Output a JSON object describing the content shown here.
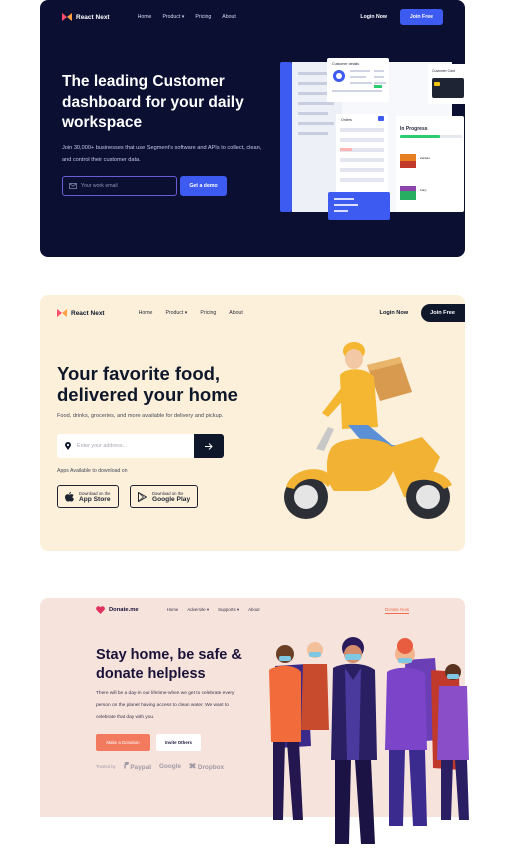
{
  "card1": {
    "brand": "React Next",
    "nav": [
      "Home",
      "Product ▾",
      "Pricing",
      "About"
    ],
    "login": "Login Now",
    "join": "Join Free",
    "title": "The leading Customer dashboard for your daily workspace",
    "subtitle": "Join 30,000+ businesses that use Segment's software and APIs to collect, clean, and control their customer data.",
    "email_placeholder": "Your work email",
    "demo_label": "Get a demo",
    "mock": {
      "customer_details": "Customer details",
      "orders": "Orders",
      "in_progress": "In Progress",
      "customer_card": "Customer Card",
      "book1": "Zeldaro — Palette Rivals",
      "book2": "Let a Fairy Dream"
    },
    "colors": {
      "background": "#0b1033",
      "accent": "#3d5af1"
    }
  },
  "card2": {
    "brand": "React Next",
    "nav": [
      "Home",
      "Product ▾",
      "Pricing",
      "About"
    ],
    "login": "Login Now",
    "join": "Join Free",
    "title": "Your favorite food, delivered your home",
    "subtitle": "Food, drinks, groceries, and more available for delivery and pickup.",
    "address_placeholder": "Enter your address...",
    "apps_label": "Apps Available to download on",
    "appstore_small": "Download on the",
    "appstore_big": "App Store",
    "play_small": "Download on the",
    "play_big": "Google Play",
    "colors": {
      "background": "#fdf0db",
      "dark": "#0f172a"
    }
  },
  "card3": {
    "brand": "Donate.me",
    "nav": [
      "Home",
      "Adversite ▾",
      "Supports ▾",
      "About"
    ],
    "donate_nav": "Donate Now",
    "title": "Stay home, be safe & donate helpless",
    "subtitle": "There will be a day-in our lifetime-when we get to celebrate every person on the planet having access to clean water. We want to celebrate that day with you.",
    "make_donation": "Make a Donation",
    "invite": "Invite Others",
    "trusted_label": "Trusted by",
    "brands": [
      "Paypal",
      "Google",
      "Dropbox"
    ],
    "colors": {
      "background": "#f6e4dc",
      "accent": "#f27a5e"
    }
  }
}
